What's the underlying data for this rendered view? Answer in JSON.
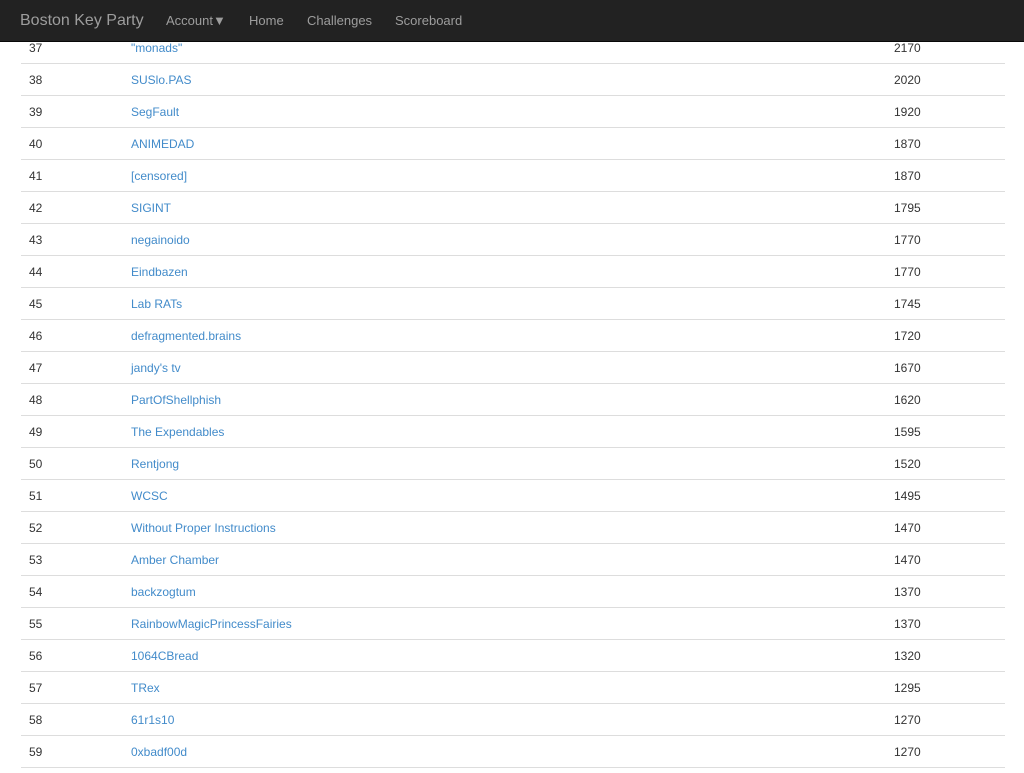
{
  "navbar": {
    "brand": "Boston Key Party",
    "items": {
      "account": "Account▼",
      "home": "Home",
      "challenges": "Challenges",
      "scoreboard": "Scoreboard"
    }
  },
  "scoreboard": {
    "rows": [
      {
        "rank": "37",
        "team": "\"monads\"",
        "score": "2170"
      },
      {
        "rank": "38",
        "team": "SUSlo.PAS",
        "score": "2020"
      },
      {
        "rank": "39",
        "team": "SegFault",
        "score": "1920"
      },
      {
        "rank": "40",
        "team": "ANIMEDAD",
        "score": "1870"
      },
      {
        "rank": "41",
        "team": "[censored]",
        "score": "1870"
      },
      {
        "rank": "42",
        "team": "SIGINT",
        "score": "1795"
      },
      {
        "rank": "43",
        "team": "negainoido",
        "score": "1770"
      },
      {
        "rank": "44",
        "team": "Eindbazen",
        "score": "1770"
      },
      {
        "rank": "45",
        "team": "Lab RATs",
        "score": "1745"
      },
      {
        "rank": "46",
        "team": "defragmented.brains",
        "score": "1720"
      },
      {
        "rank": "47",
        "team": "jandy's tv",
        "score": "1670"
      },
      {
        "rank": "48",
        "team": "PartOfShellphish",
        "score": "1620"
      },
      {
        "rank": "49",
        "team": "The Expendables",
        "score": "1595"
      },
      {
        "rank": "50",
        "team": "Rentjong",
        "score": "1520"
      },
      {
        "rank": "51",
        "team": "WCSC",
        "score": "1495"
      },
      {
        "rank": "52",
        "team": "Without Proper Instructions",
        "score": "1470"
      },
      {
        "rank": "53",
        "team": "Amber Chamber",
        "score": "1470"
      },
      {
        "rank": "54",
        "team": "backzogtum",
        "score": "1370"
      },
      {
        "rank": "55",
        "team": "RainbowMagicPrincessFairies",
        "score": "1370"
      },
      {
        "rank": "56",
        "team": "1064CBread",
        "score": "1320"
      },
      {
        "rank": "57",
        "team": "TRex",
        "score": "1295"
      },
      {
        "rank": "58",
        "team": "61r1s10",
        "score": "1270"
      },
      {
        "rank": "59",
        "team": "0xbadf00d",
        "score": "1270"
      }
    ]
  },
  "colors": {
    "navbar_bg": "#222222",
    "navbar_text": "#9d9d9d",
    "link": "#428bca",
    "text": "#333333",
    "row_border": "#dddddd"
  }
}
